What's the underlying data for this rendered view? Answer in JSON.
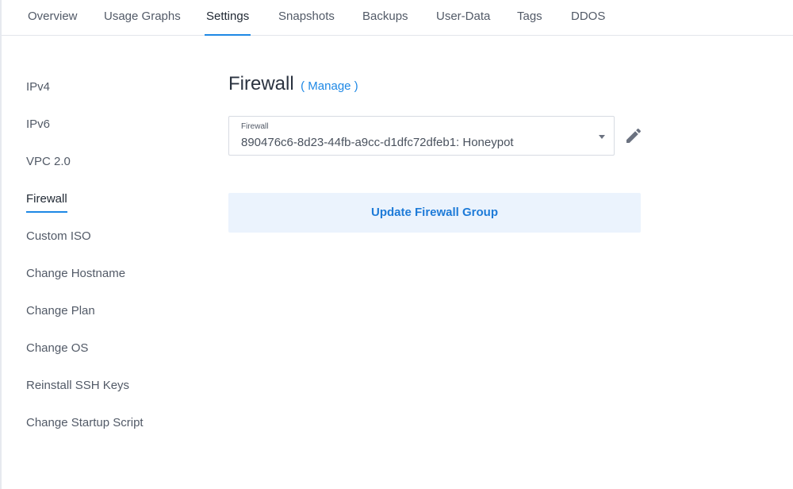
{
  "tabs": [
    {
      "label": "Overview"
    },
    {
      "label": "Usage Graphs"
    },
    {
      "label": "Settings",
      "active": true
    },
    {
      "label": "Snapshots"
    },
    {
      "label": "Backups"
    },
    {
      "label": "User-Data"
    },
    {
      "label": "Tags"
    },
    {
      "label": "DDOS"
    }
  ],
  "sidebar": {
    "items": [
      {
        "label": "IPv4"
      },
      {
        "label": "IPv6"
      },
      {
        "label": "VPC 2.0"
      },
      {
        "label": "Firewall",
        "active": true
      },
      {
        "label": "Custom ISO"
      },
      {
        "label": "Change Hostname"
      },
      {
        "label": "Change Plan"
      },
      {
        "label": "Change OS"
      },
      {
        "label": "Reinstall SSH Keys"
      },
      {
        "label": "Change Startup Script"
      }
    ]
  },
  "main": {
    "title": "Firewall",
    "manage_link": "( Manage )",
    "firewall_select": {
      "label": "Firewall",
      "value": "890476c6-8d23-44fb-a9cc-d1dfc72dfeb1: Honeypot"
    },
    "edit_icon": "pencil-icon",
    "update_button": "Update Firewall Group"
  },
  "colors": {
    "accent": "#1e88e5",
    "button_bg": "#ebf3fd",
    "text": "#525a67"
  }
}
